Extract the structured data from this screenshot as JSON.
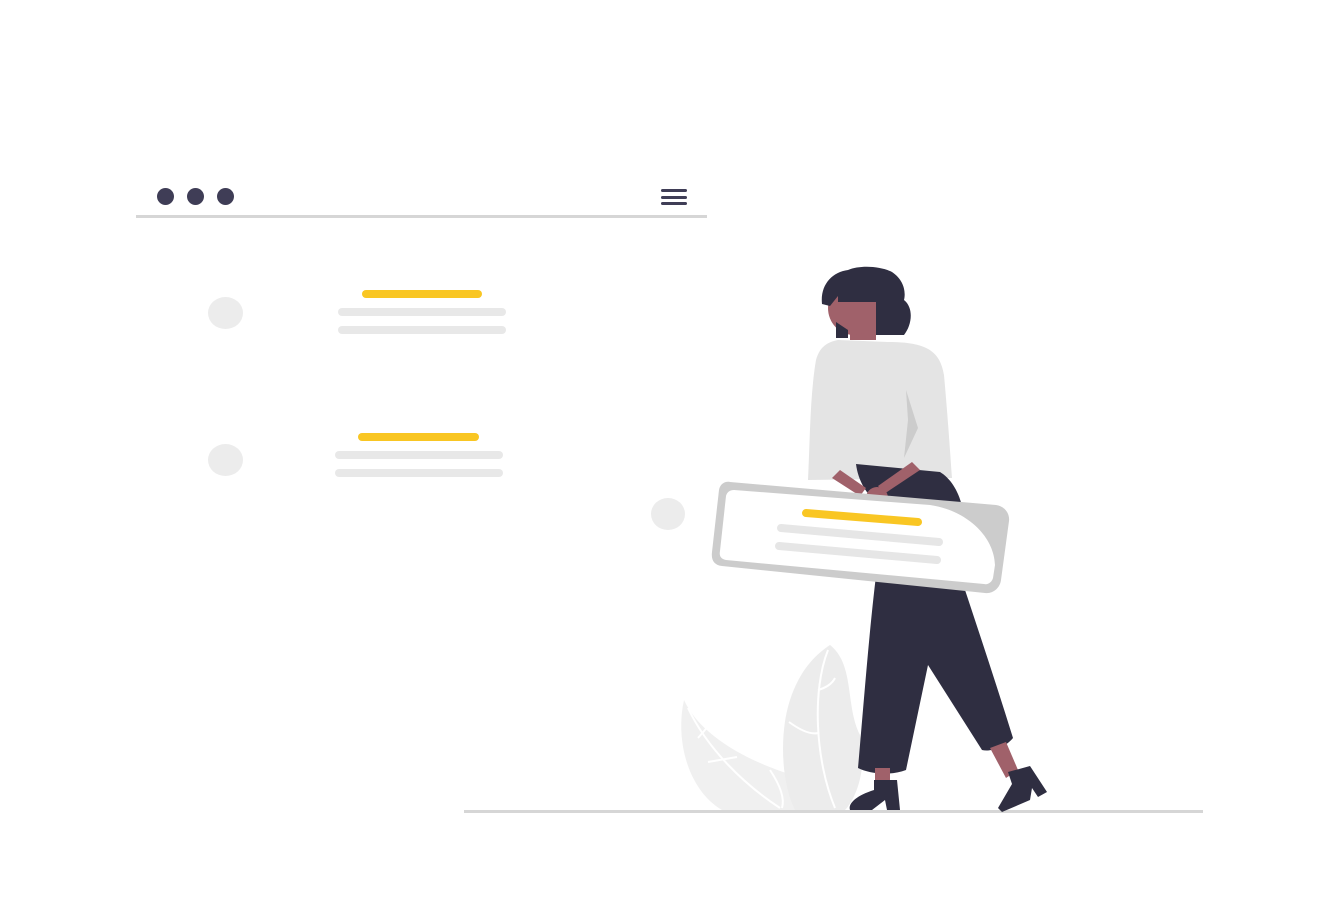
{
  "colors": {
    "accent": "#f9c623",
    "dark": "#3f3d56",
    "figure_dark": "#2f2e41",
    "skin": "#a0616a",
    "placeholder": "#e6e6e6",
    "divider": "#d6d6d6"
  },
  "header": {
    "window_controls": [
      "dot-icon",
      "dot-icon",
      "dot-icon"
    ],
    "menu_icon": "hamburger-menu-icon"
  },
  "list": {
    "items": [
      {
        "avatar": "avatar-placeholder",
        "title_bar": "accent",
        "text_lines": 2
      },
      {
        "avatar": "avatar-placeholder",
        "title_bar": "accent",
        "text_lines": 2
      }
    ]
  },
  "dragged_card": {
    "avatar": "avatar-placeholder",
    "title_bar": "accent",
    "text_lines": 2
  }
}
